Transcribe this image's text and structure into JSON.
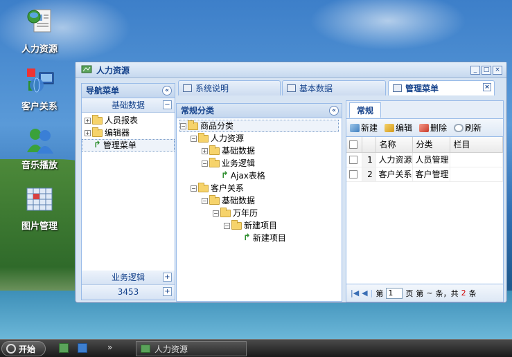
{
  "desktop": {
    "icons": [
      {
        "label": "人力资源",
        "icon": "hr-contacts-icon"
      },
      {
        "label": "客户关系",
        "icon": "crm-network-icon"
      },
      {
        "label": "音乐播放",
        "icon": "music-people-icon"
      },
      {
        "label": "图片管理",
        "icon": "picture-grid-icon"
      }
    ]
  },
  "taskbar": {
    "start_label": "开始",
    "quick_launch_arrows": "»",
    "task_label": "人力资源"
  },
  "window": {
    "title": "人力资源",
    "controls": {
      "minimize": "_",
      "maximize": "□",
      "close": "×"
    }
  },
  "nav": {
    "header": "导航菜单",
    "collapse_glyph": "«",
    "sections": [
      {
        "label": "基础数据",
        "toggle": "−"
      },
      {
        "label": "业务逻辑",
        "toggle": "+"
      },
      {
        "label": "3453",
        "toggle": "+"
      }
    ],
    "items": [
      {
        "label": "人员报表"
      },
      {
        "label": "编辑器"
      },
      {
        "label": "管理菜单"
      }
    ]
  },
  "tabs": [
    {
      "label": "系统说明"
    },
    {
      "label": "基本数据"
    },
    {
      "label": "管理菜单",
      "close": "×"
    }
  ],
  "categories": {
    "header": "常规分类",
    "collapse_glyph": "«",
    "nodes": [
      {
        "label": "商品分类"
      },
      {
        "label": "人力资源"
      },
      {
        "label": "基础数据"
      },
      {
        "label": "业务逻辑"
      },
      {
        "label": "Ajax表格"
      },
      {
        "label": "客户关系"
      },
      {
        "label": "基础数据"
      },
      {
        "label": "万年历"
      },
      {
        "label": "新建项目"
      },
      {
        "label": "新建项目"
      }
    ]
  },
  "grid": {
    "tab_label": "常规",
    "toolbar": {
      "new": "新建",
      "edit": "编辑",
      "delete": "删除",
      "refresh": "刷新"
    },
    "columns": [
      "名称",
      "分类",
      "栏目"
    ],
    "rows": [
      {
        "num": "1",
        "name": "人力资源",
        "category": "人员管理",
        "column": ""
      },
      {
        "num": "2",
        "name": "客户关系",
        "category": "客户管理",
        "column": ""
      }
    ],
    "pager": {
      "page_prefix": "第",
      "page_value": "1",
      "page_suffix": "页",
      "range_text": "第",
      "range_mid": "~",
      "range_end": "条，共",
      "total": "2",
      "unit": "条",
      "first": "|◀",
      "prev": "◀"
    }
  },
  "colors": {
    "accent": "#15428b",
    "border": "#99bbe8",
    "total_highlight": "#d00000"
  }
}
